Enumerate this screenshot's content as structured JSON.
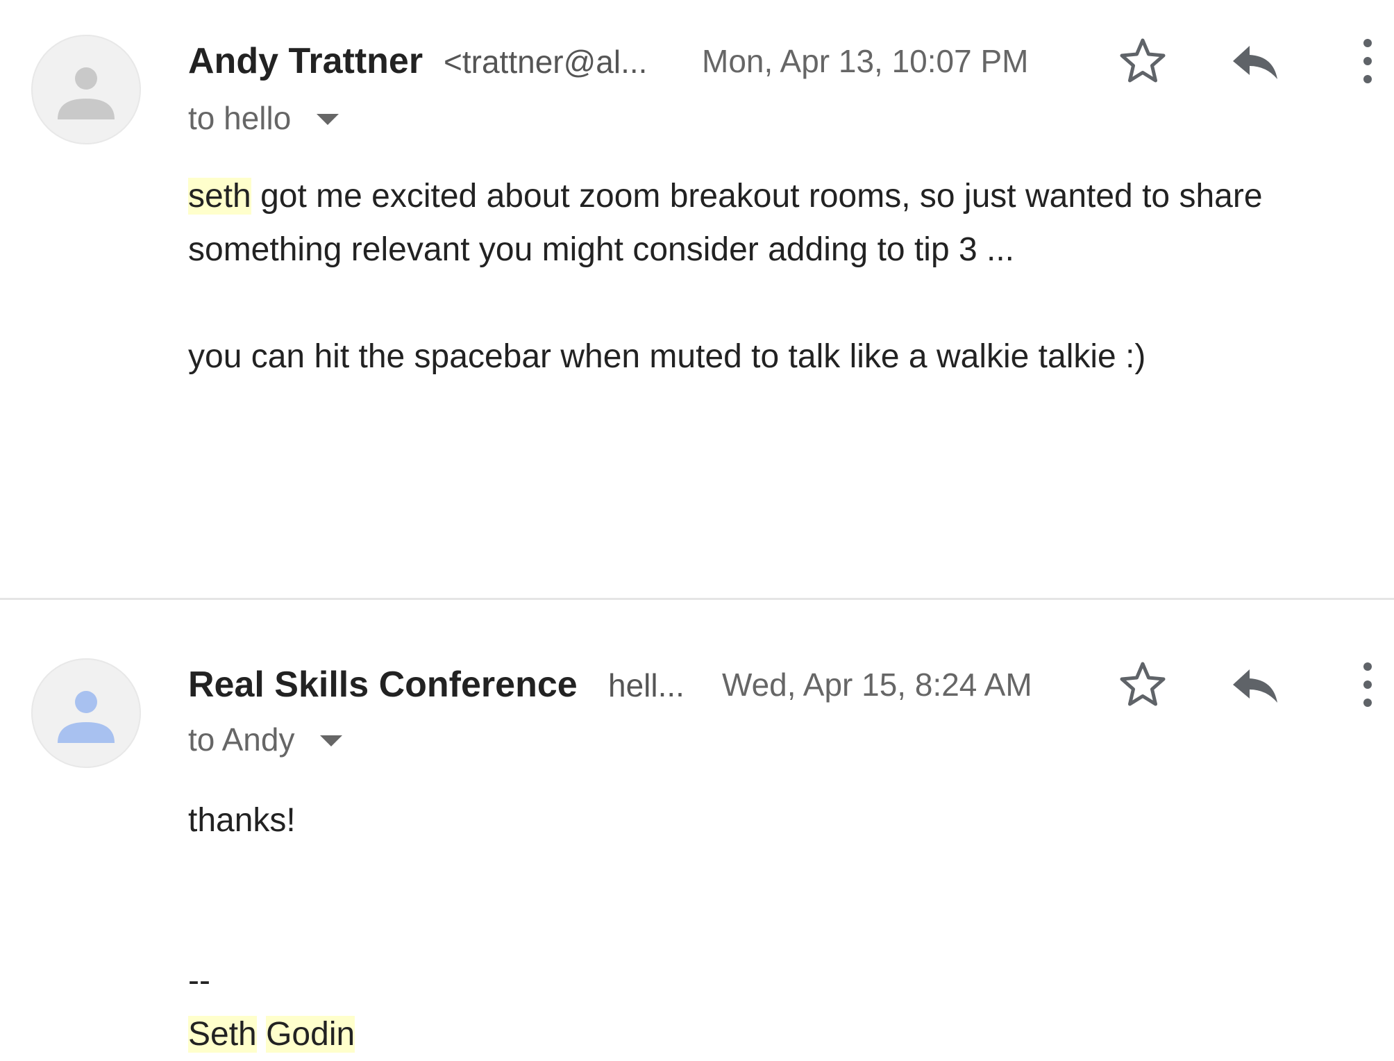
{
  "messages": [
    {
      "sender_name": "Andy Trattner",
      "sender_email": "<trattner@al...",
      "date": "Mon, Apr 13, 10:07 PM",
      "to": "to hello",
      "body": {
        "p1_highlight": "seth",
        "p1_rest": " got me excited about zoom breakout rooms, so just wanted to share something relevant you might consider adding to tip 3 ...",
        "p2": "you can hit the spacebar when muted to talk like a walkie talkie :)"
      },
      "avatar_color": "#c9c9c9"
    },
    {
      "sender_name": "Real Skills Conference",
      "sender_email": "hell...",
      "date": "Wed, Apr 15, 8:24 AM",
      "to": "to Andy",
      "body": {
        "p1": "thanks!",
        "sig_dash": "--",
        "sig_first": "Seth",
        "sig_last": "Godin"
      },
      "avatar_color": "#a8c1f0"
    }
  ],
  "icons": {
    "star": "star-icon",
    "reply": "reply-icon",
    "more": "more-vert-icon",
    "dropdown": "caret-down-icon",
    "avatar": "person-icon"
  },
  "colors": {
    "highlight": "#ffffcc",
    "icon": "#5f6368"
  }
}
